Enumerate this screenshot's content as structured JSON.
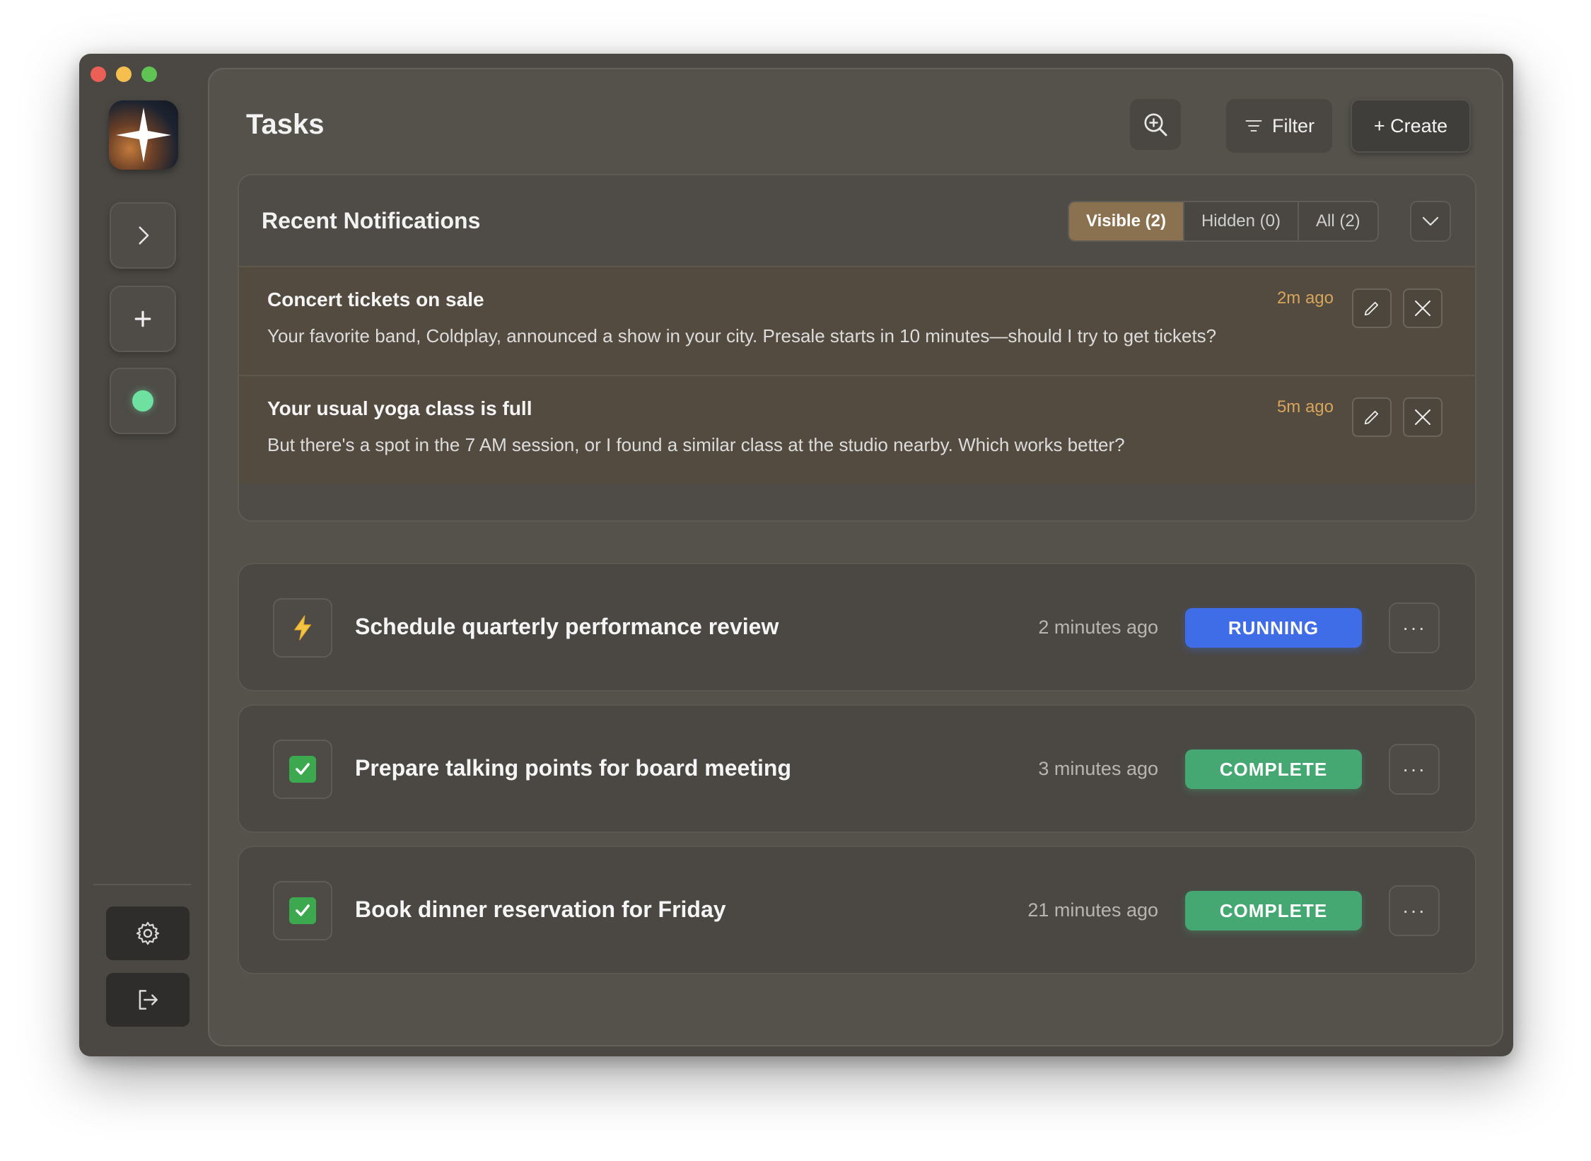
{
  "window": {
    "traffic_lights": [
      "close",
      "minimize",
      "maximize"
    ]
  },
  "sidebar": {
    "logo_icon": "sparkle-star-icon",
    "buttons": [
      {
        "name": "expand",
        "icon": "chevron-right-icon"
      },
      {
        "name": "new",
        "icon": "plus-icon"
      },
      {
        "name": "status",
        "icon": "status-dot-icon",
        "color": "#6ee0a0"
      }
    ],
    "bottom_buttons": [
      {
        "name": "settings",
        "icon": "gear-icon"
      },
      {
        "name": "logout",
        "icon": "logout-icon"
      }
    ]
  },
  "header": {
    "title": "Tasks",
    "filter_label": "Filter",
    "create_label": "+ Create"
  },
  "notifications": {
    "title": "Recent Notifications",
    "tabs": [
      {
        "label": "Visible (2)",
        "active": true
      },
      {
        "label": "Hidden (0)",
        "active": false
      },
      {
        "label": "All (2)",
        "active": false
      }
    ],
    "items": [
      {
        "title": "Concert tickets on sale",
        "body": "Your favorite band, Coldplay, announced a show in your city. Presale starts in 10 minutes—should I try to get tickets?",
        "time": "2m ago"
      },
      {
        "title": "Your usual yoga class is full",
        "body": "But there's a spot in the 7 AM session, or I found a similar class at the studio nearby. Which works better?",
        "time": "5m ago"
      }
    ]
  },
  "tasks": [
    {
      "title": "Schedule quarterly performance review",
      "time": "2 minutes ago",
      "status": "RUNNING",
      "icon": "lightning-icon"
    },
    {
      "title": "Prepare talking points for board meeting",
      "time": "3 minutes ago",
      "status": "COMPLETE",
      "icon": "checkmark-icon"
    },
    {
      "title": "Book dinner reservation for Friday",
      "time": "21 minutes ago",
      "status": "COMPLETE",
      "icon": "checkmark-icon"
    }
  ],
  "colors": {
    "accent_tab": "#8a7251",
    "running": "#3f6de8",
    "complete": "#45a872",
    "notif_time": "#d6a55c"
  }
}
